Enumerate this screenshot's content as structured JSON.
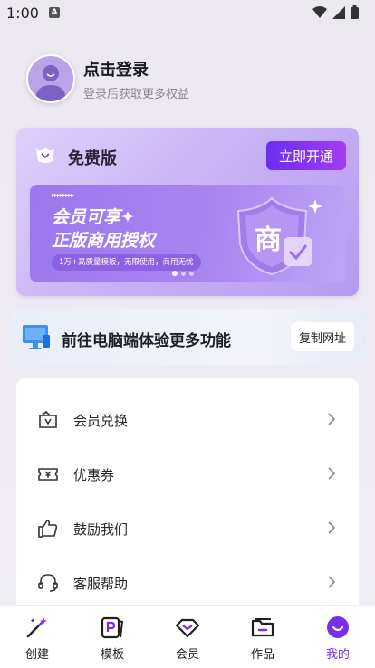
{
  "status_bar": {
    "time": "1:00",
    "sim_label": "A"
  },
  "profile": {
    "title": "点击登录",
    "subtitle": "登录后获取更多权益"
  },
  "vip": {
    "plan": "免费版",
    "open_button": "立即开通",
    "banner": {
      "arrows": "▸▸▸▸▸▸▸▸",
      "line1": "会员可享✦",
      "line2": "正版商用授权",
      "pill": "1万+高质量模板，无限使用，商用无忧",
      "badge_char": "商"
    },
    "carousel": {
      "count": 3,
      "active": 0
    }
  },
  "pc_promo": {
    "text": "前往电脑端体验更多功能",
    "copy_button": "复制网址"
  },
  "menu": [
    {
      "label": "会员兑换",
      "icon": "ticket-icon"
    },
    {
      "label": "优惠券",
      "icon": "coupon-icon"
    },
    {
      "label": "鼓励我们",
      "icon": "thumbs-up-icon"
    },
    {
      "label": "客服帮助",
      "icon": "headset-icon"
    }
  ],
  "tabs": [
    {
      "label": "创建",
      "icon": "magic-wand-icon"
    },
    {
      "label": "模板",
      "icon": "template-icon"
    },
    {
      "label": "会员",
      "icon": "diamond-icon"
    },
    {
      "label": "作品",
      "icon": "folder-icon"
    },
    {
      "label": "我的",
      "icon": "profile-icon",
      "active": true
    }
  ],
  "colors": {
    "accent": "#7a2ee8",
    "button_start": "#6a2df0",
    "button_end": "#a33df2",
    "card": "#c9b4f6"
  }
}
